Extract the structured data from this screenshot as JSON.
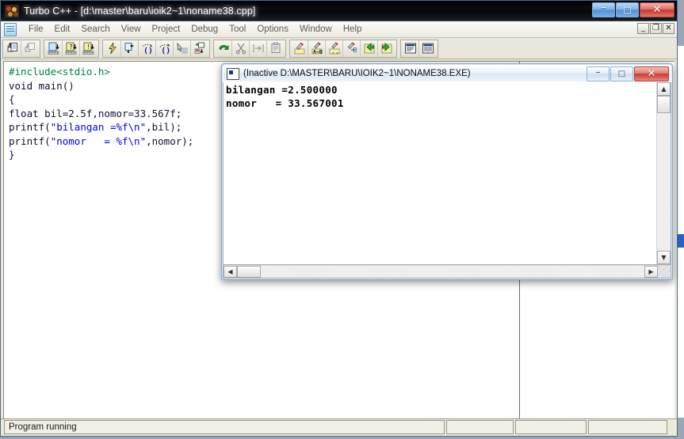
{
  "window": {
    "title": "Turbo C++ - [d:\\master\\baru\\ioik2~1\\noname38.cpp]",
    "app_icon": "turbo-cpp-icon",
    "buttons": {
      "minimize": "–",
      "maximize": "□",
      "close": "✕"
    },
    "mdi_buttons": {
      "minimize": "_",
      "restore": "❐",
      "close": "✕"
    }
  },
  "menubar": {
    "doc_icon": "document-icon",
    "items": [
      {
        "label": "File"
      },
      {
        "label": "Edit"
      },
      {
        "label": "Search"
      },
      {
        "label": "View"
      },
      {
        "label": "Project"
      },
      {
        "label": "Debug"
      },
      {
        "label": "Tool"
      },
      {
        "label": "Options"
      },
      {
        "label": "Window"
      },
      {
        "label": "Help"
      }
    ]
  },
  "toolbar": {
    "groups": [
      {
        "buttons": [
          {
            "name": "open-file-icon",
            "title": "Open"
          },
          {
            "name": "save-file-icon",
            "title": "Save"
          }
        ]
      },
      {
        "buttons": [
          {
            "name": "compile-icon",
            "title": "Compile"
          },
          {
            "name": "make-icon",
            "title": "Make"
          },
          {
            "name": "build-icon",
            "title": "Build"
          }
        ]
      },
      {
        "buttons": [
          {
            "name": "run-icon",
            "title": "Run"
          },
          {
            "name": "step-over-icon",
            "title": "Step over"
          },
          {
            "name": "trace-into-icon",
            "title": "Trace into"
          },
          {
            "name": "step-out-icon",
            "title": "Step out"
          },
          {
            "name": "goto-cursor-icon",
            "title": "Go to cursor"
          },
          {
            "name": "toggle-breakpoint-icon",
            "title": "Toggle breakpoint"
          }
        ]
      },
      {
        "buttons": [
          {
            "name": "undo-icon",
            "title": "Undo"
          },
          {
            "name": "cut-icon",
            "title": "Cut"
          },
          {
            "name": "copy-icon",
            "title": "Copy"
          },
          {
            "name": "paste-icon",
            "title": "Paste"
          }
        ]
      },
      {
        "buttons": [
          {
            "name": "search-icon",
            "title": "Find"
          },
          {
            "name": "replace-icon",
            "title": "Replace"
          },
          {
            "name": "search-again-icon",
            "title": "Search again"
          },
          {
            "name": "search-options-icon",
            "title": "Search options"
          },
          {
            "name": "previous-bookmark-icon",
            "title": "Previous"
          },
          {
            "name": "next-bookmark-icon",
            "title": "Next"
          }
        ]
      },
      {
        "buttons": [
          {
            "name": "message-window-icon",
            "title": "Messages"
          },
          {
            "name": "project-window-icon",
            "title": "Project"
          }
        ]
      }
    ]
  },
  "editor": {
    "lines": [
      {
        "segments": [
          {
            "cls": "tok-pre",
            "text": "#include<stdio.h>"
          }
        ]
      },
      {
        "segments": [
          {
            "cls": "tok-plain",
            "text": "void main()"
          }
        ]
      },
      {
        "segments": [
          {
            "cls": "tok-plain",
            "text": "{"
          }
        ]
      },
      {
        "segments": [
          {
            "cls": "tok-plain",
            "text": "float bil=2.5f,nomor=33.567f;"
          }
        ]
      },
      {
        "segments": [
          {
            "cls": "tok-plain",
            "text": "printf("
          },
          {
            "cls": "tok-str",
            "text": "\"bilangan =%f\\n\""
          },
          {
            "cls": "tok-plain",
            "text": ",bil);"
          }
        ]
      },
      {
        "segments": [
          {
            "cls": "tok-plain",
            "text": "printf("
          },
          {
            "cls": "tok-str",
            "text": "\"nomor   = %f\\n\""
          },
          {
            "cls": "tok-plain",
            "text": ",nomor);"
          }
        ]
      },
      {
        "segments": [
          {
            "cls": "tok-plain",
            "text": "}"
          }
        ]
      }
    ]
  },
  "console": {
    "icon": "console-window-icon",
    "title": "(Inactive D:\\MASTER\\BARU\\IOIK2~1\\NONAME38.EXE)",
    "buttons": {
      "minimize": "–",
      "maximize": "□",
      "close": "✕"
    },
    "output_lines": [
      "bilangan =2.500000",
      "nomor   = 33.567001"
    ],
    "scroll": {
      "up_arrow": "▲",
      "down_arrow": "▼",
      "left_arrow": "◀",
      "right_arrow": "▶"
    }
  },
  "statusbar": {
    "message": "Program running",
    "panel2": "",
    "panel3": "",
    "panel4": ""
  },
  "colors": {
    "preprocessor": "#008040",
    "string": "#0000e0",
    "code": "#101030",
    "window_chrome": "#ece9d8",
    "close_button": "#c53a30"
  }
}
